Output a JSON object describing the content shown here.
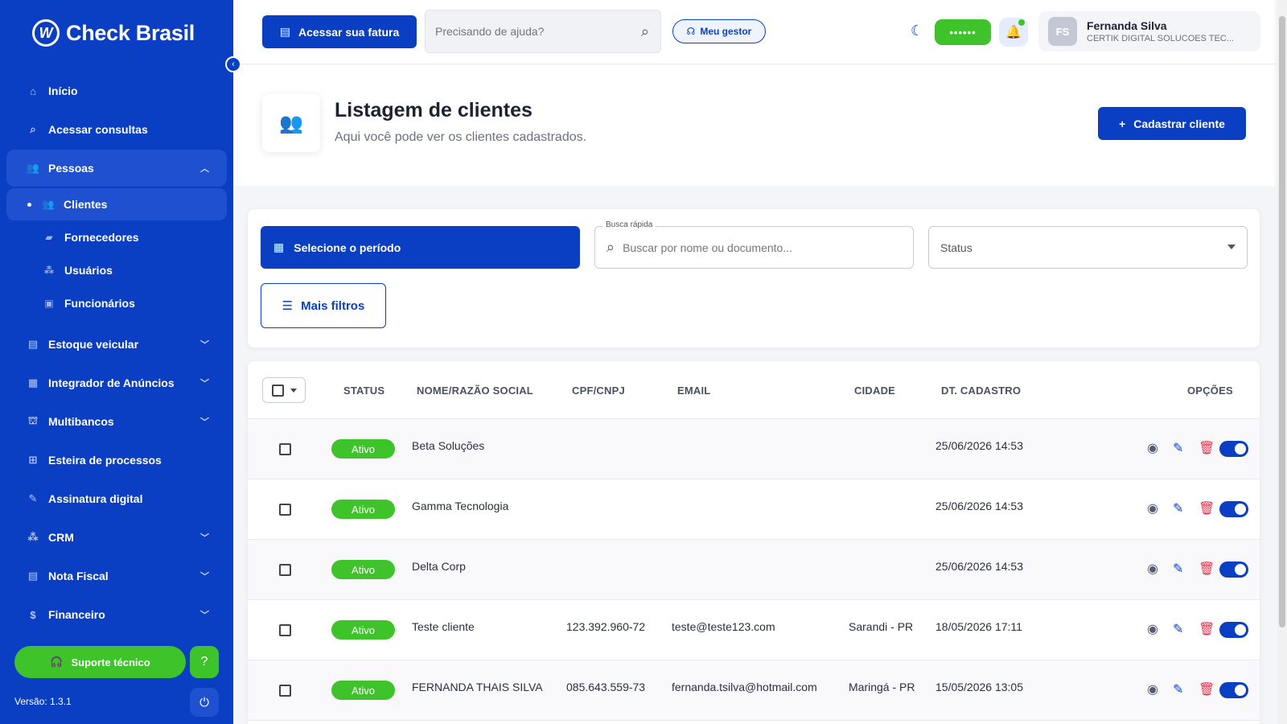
{
  "sidebar": {
    "logo_text": "Check Brasil",
    "logo_mark": "W",
    "items": [
      {
        "label": "Início",
        "icon": "home-icon"
      },
      {
        "label": "Acessar consultas",
        "icon": "search-icon"
      },
      {
        "label": "Pessoas",
        "icon": "people-icon"
      },
      {
        "label": "Estoque veicular",
        "icon": "vehicle-stock-icon"
      },
      {
        "label": "Integrador de Anúncios",
        "icon": "ads-icon"
      },
      {
        "label": "Multibancos",
        "icon": "bank-icon"
      },
      {
        "label": "Esteira de processos",
        "icon": "process-icon"
      },
      {
        "label": "Assinatura digital",
        "icon": "signature-icon"
      },
      {
        "label": "CRM",
        "icon": "crm-icon"
      },
      {
        "label": "Nota Fiscal",
        "icon": "invoice-icon"
      },
      {
        "label": "Financeiro",
        "icon": "finance-icon"
      }
    ],
    "sub_items": [
      {
        "label": "Clientes",
        "icon": "clients-icon"
      },
      {
        "label": "Fornecedores",
        "icon": "truck-icon"
      },
      {
        "label": "Usuários",
        "icon": "users-icon"
      },
      {
        "label": "Funcionários",
        "icon": "badge-icon"
      }
    ],
    "support_label": "Suporte técnico",
    "version": "Versão: 1.3.1"
  },
  "header": {
    "fatura_label": "Acessar sua fatura",
    "help_placeholder": "Precisando de ajuda?",
    "gestor_label": "Meu gestor",
    "password_mask": "••••••",
    "user_initials": "FS",
    "user_name": "Fernanda Silva",
    "user_company": "CERTIK DIGITAL SOLUCOES TEC..."
  },
  "page": {
    "title": "Listagem de clientes",
    "subtitle": "Aqui você pode ver os clientes cadastrados.",
    "add_button": "Cadastrar cliente"
  },
  "filters": {
    "period_label": "Selecione o período",
    "quick_search_label": "Busca rápida",
    "quick_search_placeholder": "Buscar por nome ou documento...",
    "status_label": "Status",
    "more_filters_label": "Mais filtros"
  },
  "table": {
    "columns": [
      "STATUS",
      "NOME/RAZÃO SOCIAL",
      "CPF/CNPJ",
      "EMAIL",
      "CIDADE",
      "DT. CADASTRO",
      "OPÇÕES"
    ],
    "rows": [
      {
        "status": "Ativo",
        "name": "Beta Soluções",
        "doc": "",
        "email": "",
        "city": "",
        "date": "25/06/2026 14:53"
      },
      {
        "status": "Ativo",
        "name": "Gamma Tecnologia",
        "doc": "",
        "email": "",
        "city": "",
        "date": "25/06/2026 14:53"
      },
      {
        "status": "Ativo",
        "name": "Delta Corp",
        "doc": "",
        "email": "",
        "city": "",
        "date": "25/06/2026 14:53"
      },
      {
        "status": "Ativo",
        "name": "Teste cliente",
        "doc": "123.392.960-72",
        "email": "teste@teste123.com",
        "city": "Sarandi - PR",
        "date": "18/05/2026 17:11"
      },
      {
        "status": "Ativo",
        "name": "FERNANDA THAIS SILVA",
        "doc": "085.643.559-73",
        "email": "fernanda.tsilva@hotmail.com",
        "city": "Maringá - PR",
        "date": "15/05/2026 13:05"
      }
    ]
  },
  "colors": {
    "primary": "#0a3fc4",
    "success": "#3ec42a",
    "danger": "#e8314a"
  }
}
